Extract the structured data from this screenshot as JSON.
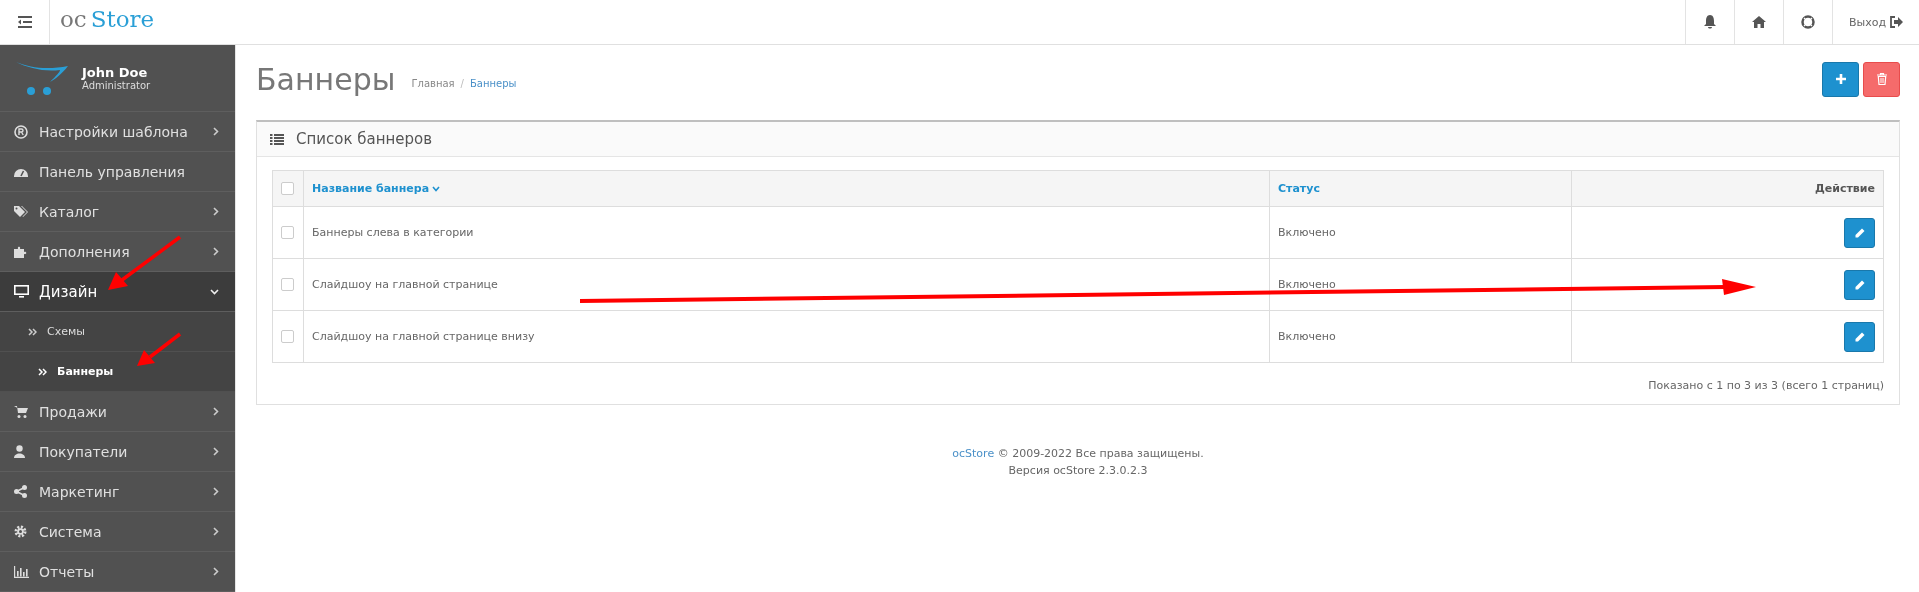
{
  "header": {
    "logo_prefix": "oc",
    "logo_main": "Store",
    "logout": "Выход"
  },
  "profile": {
    "name": "John Doe",
    "role": "Administrator"
  },
  "sidebar": {
    "items": [
      {
        "label": "Настройки шаблона",
        "kind": "group",
        "expanded": false
      },
      {
        "label": "Панель управления",
        "kind": "link"
      },
      {
        "label": "Каталог",
        "kind": "group",
        "expanded": false
      },
      {
        "label": "Дополнения",
        "kind": "group",
        "expanded": false
      },
      {
        "label": "Дизайн",
        "kind": "group",
        "expanded": true,
        "children": [
          {
            "label": "Схемы",
            "selected": false
          },
          {
            "label": "Баннеры",
            "selected": true
          }
        ]
      },
      {
        "label": "Продажи",
        "kind": "group",
        "expanded": false
      },
      {
        "label": "Покупатели",
        "kind": "group",
        "expanded": false
      },
      {
        "label": "Маркетинг",
        "kind": "group",
        "expanded": false
      },
      {
        "label": "Система",
        "kind": "group",
        "expanded": false
      },
      {
        "label": "Отчеты",
        "kind": "group",
        "expanded": false
      }
    ]
  },
  "page": {
    "title": "Баннеры",
    "breadcrumb_separator": "/",
    "breadcrumbs": [
      {
        "label": "Главная",
        "selected": false
      },
      {
        "label": "Баннеры",
        "selected": true
      }
    ]
  },
  "panel": {
    "title": "Список баннеров",
    "table": {
      "select_all_checked": false,
      "columns": [
        {
          "label": "Название баннера",
          "kind": "sortable",
          "sorted": true
        },
        {
          "label": "Статус",
          "kind": "sortable",
          "sorted": false
        },
        {
          "label": "Действие",
          "kind": "plain"
        }
      ],
      "rows": [
        {
          "checked": false,
          "name": "Баннеры слева в категории",
          "status": "Включено"
        },
        {
          "checked": false,
          "name": "Слайдшоу на главной странице",
          "status": "Включено"
        },
        {
          "checked": false,
          "name": "Слайдшоу на главной странице внизу",
          "status": "Включено"
        }
      ]
    },
    "pagination_info": "Показано с 1 по 3 из 3 (всего 1 страниц)"
  },
  "footer": {
    "link": "ocStore",
    "copyright": "© 2009-2022 Все права защищены.",
    "version": "Версия ocStore 2.3.0.2.3"
  }
}
